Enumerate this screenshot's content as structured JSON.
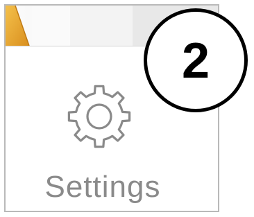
{
  "settings_tile": {
    "label": "Settings",
    "icon": "gear-icon"
  },
  "step_badge": {
    "number": "2"
  },
  "top_strip": {
    "corner_icon": "folder-corner-icon"
  },
  "colors": {
    "label": "#8a8a8a",
    "icon_stroke": "#8a8a8a",
    "badge_border": "#000000",
    "corner_accent": "#e9a52c"
  }
}
